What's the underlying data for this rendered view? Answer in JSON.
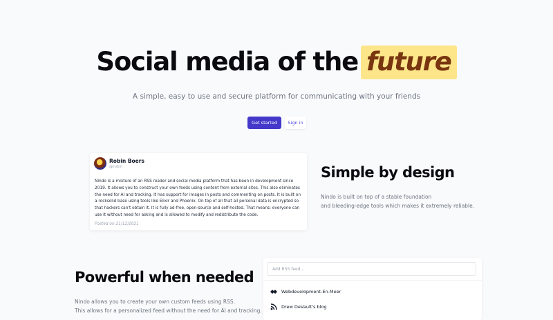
{
  "hero": {
    "title_main": "Social media of the",
    "title_highlight": "future",
    "tagline": "A simple, easy to use and secure platform for communicating with your friends",
    "primary_button": "Get started",
    "secondary_button": "Sign in"
  },
  "post": {
    "author": "Robin Boers",
    "handle": "@robin",
    "body": "Nindo is a mixture of an RSS reader and social media platform that has been in development since 2019. It allows you to construct your own feeds using content from external sites. This also eliminates the need for AI and tracking. It has support for images in posts and commenting on posts. It is built on a rocksolid base using tools like Elixir and Phoenix. On top of all that all personal data is encrypted so that hackers can't obtain it. It is fully ad-free, open-source and self-hosted. That means: everyone can use it without need for asking and is allowed to modify and redistribute the code.",
    "date": "Posted on 21/12/2021"
  },
  "simple": {
    "title": "Simple by design",
    "line1": "Nindo is built on top of a stable foundation",
    "line2": "and bleeding-edge tools which makes it extremely reliable."
  },
  "powerful": {
    "title": "Powerful when needed",
    "line1": "Nindo allows you to create your own custom feeds using RSS.",
    "line2": "This allows for a personalized feed without the need for AI and tracking."
  },
  "rss": {
    "placeholder": "Add RSS feed...",
    "feeds": [
      {
        "label": "Webdevelopment-En-Meer",
        "icon": "feed-logo-icon"
      },
      {
        "label": "Drew DeVault's blog",
        "icon": "rss-icon"
      }
    ]
  },
  "colors": {
    "accent": "#4338ca",
    "highlight": "#fde68a",
    "highlight_text": "#78350f"
  }
}
